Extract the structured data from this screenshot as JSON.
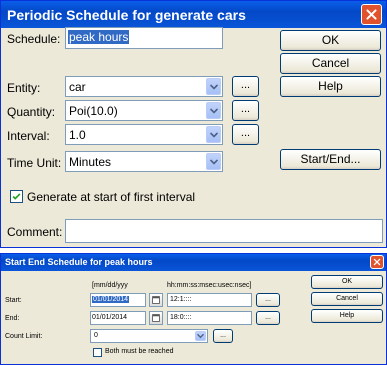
{
  "top": {
    "title": "Periodic Schedule for generate cars",
    "schedule_label": "Schedule:",
    "schedule_value": "peak hours",
    "entity_label": "Entity:",
    "entity_value": "car",
    "quantity_label": "Quantity:",
    "quantity_value": "Poi(10.0)",
    "interval_label": "Interval:",
    "interval_value": "1.0",
    "time_unit_label": "Time Unit:",
    "time_unit_value": "Minutes",
    "generate_label": "Generate at start of first interval",
    "generate_checked": true,
    "comment_label": "Comment:",
    "comment_value": "",
    "ok": "OK",
    "cancel": "Cancel",
    "help": "Help",
    "start_end": "Start/End...",
    "ellipsis": "..."
  },
  "bottom": {
    "title": "Start End Schedule for peak hours",
    "date_header": "[mm/dd/yyy",
    "time_header": "hh:mm:ss:msec:usec:nsec]",
    "start_label": "Start:",
    "start_date": "01/01/2014",
    "start_time": "12:1::::",
    "end_label": "End:",
    "end_date": "01/01/2014",
    "end_time": "18:0::::",
    "count_limit_label": "Count Limit:",
    "count_limit_value": "0",
    "both_label": "Both must be reached",
    "both_checked": false,
    "ok": "OK",
    "cancel": "Cancel",
    "help": "Help",
    "ellipsis": "..."
  },
  "colors": {
    "title_bar": "#0348c7",
    "dialog_bg": "#ece9d8",
    "selection": "#316ac5",
    "close_button": "#e0532d"
  }
}
